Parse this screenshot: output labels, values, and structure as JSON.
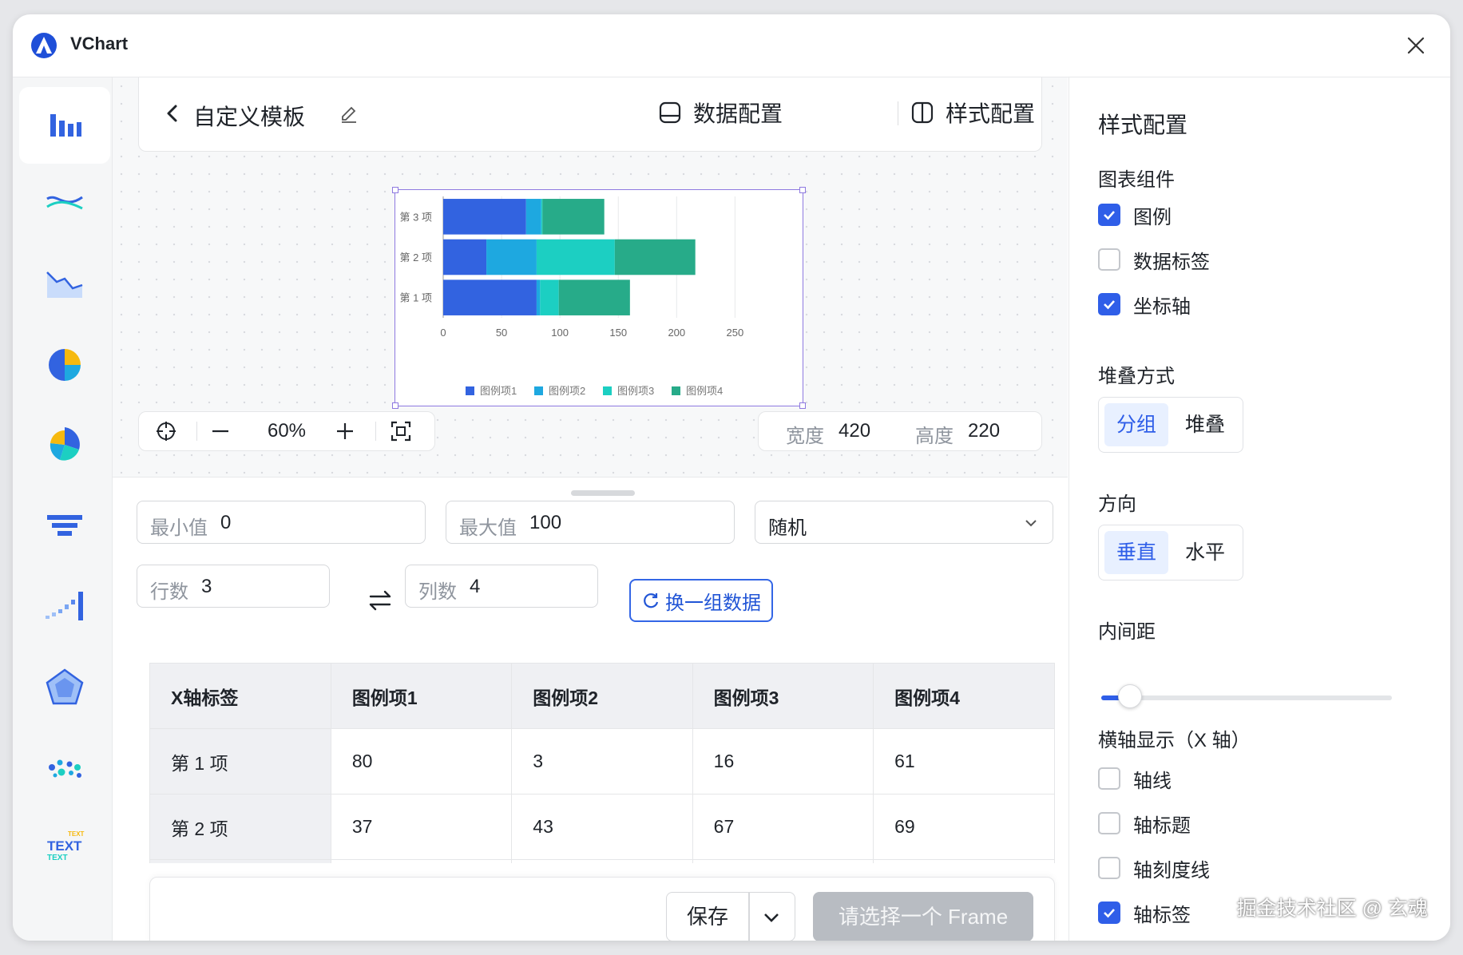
{
  "app": {
    "title": "VChart"
  },
  "colors": {
    "accent": "#2f5ee8",
    "series": [
      "#3263e0",
      "#1ea8e0",
      "#1ccfc2",
      "#27ab89"
    ]
  },
  "sidebar": {
    "items": [
      {
        "icon": "bar-chart-icon",
        "active": true
      },
      {
        "icon": "line-chart-icon"
      },
      {
        "icon": "area-chart-icon"
      },
      {
        "icon": "pie-chart-icon"
      },
      {
        "icon": "rose-chart-icon"
      },
      {
        "icon": "funnel-chart-icon"
      },
      {
        "icon": "progress-chart-icon"
      },
      {
        "icon": "radar-chart-icon"
      },
      {
        "icon": "scatter-chart-icon"
      },
      {
        "icon": "wordcloud-icon",
        "text": [
          "TEXT",
          "TEXT",
          "TEXT"
        ]
      }
    ]
  },
  "header": {
    "title": "自定义模板",
    "data_config": "数据配置",
    "style_config": "样式配置"
  },
  "chart_data": {
    "type": "bar",
    "orientation": "horizontal",
    "stacked": true,
    "categories": [
      "第 1 项",
      "第 2 项",
      "第 3 项"
    ],
    "series": [
      {
        "name": "图例项1",
        "values": [
          80,
          37,
          71
        ]
      },
      {
        "name": "图例项2",
        "values": [
          3,
          43,
          13
        ]
      },
      {
        "name": "图例项3",
        "values": [
          16,
          67,
          1
        ]
      },
      {
        "name": "图例项4",
        "values": [
          61,
          69,
          53
        ]
      }
    ],
    "x_ticks": [
      "0",
      "50",
      "100",
      "150",
      "200",
      "250"
    ],
    "xlim": [
      0,
      260
    ],
    "grid": true,
    "legend": "bottom"
  },
  "zoom": {
    "level": "60%"
  },
  "size": {
    "width_label": "宽度",
    "width": "420",
    "height_label": "高度",
    "height": "220"
  },
  "data_config": {
    "min_label": "最小值",
    "min": "0",
    "max_label": "最大值",
    "max": "100",
    "mode": "随机",
    "rows_label": "行数",
    "rows": "3",
    "cols_label": "列数",
    "cols": "4",
    "refresh_label": "换一组数据"
  },
  "table": {
    "headers": [
      "X轴标签",
      "图例项1",
      "图例项2",
      "图例项3",
      "图例项4"
    ],
    "rows": [
      [
        "第 1 项",
        "80",
        "3",
        "16",
        "61"
      ],
      [
        "第 2 项",
        "37",
        "43",
        "67",
        "69"
      ],
      [
        "",
        "",
        "",
        "",
        ""
      ]
    ]
  },
  "footer": {
    "save": "保存",
    "frame": "请选择一个 Frame"
  },
  "style_panel": {
    "title": "样式配置",
    "components_title": "图表组件",
    "components": [
      {
        "label": "图例",
        "checked": true
      },
      {
        "label": "数据标签",
        "checked": false
      },
      {
        "label": "坐标轴",
        "checked": true
      }
    ],
    "stack_title": "堆叠方式",
    "stack_options": [
      "分组",
      "堆叠"
    ],
    "direction_title": "方向",
    "direction_options": [
      "垂直",
      "水平"
    ],
    "padding_title": "内间距",
    "padding_value": 0.1,
    "xaxis_title": "横轴显示（X 轴）",
    "xaxis_options": [
      {
        "label": "轴线",
        "checked": false
      },
      {
        "label": "轴标题",
        "checked": false
      },
      {
        "label": "轴刻度线",
        "checked": false
      },
      {
        "label": "轴标签",
        "checked": true
      }
    ]
  },
  "watermark": "掘金技术社区 @ 玄魂"
}
